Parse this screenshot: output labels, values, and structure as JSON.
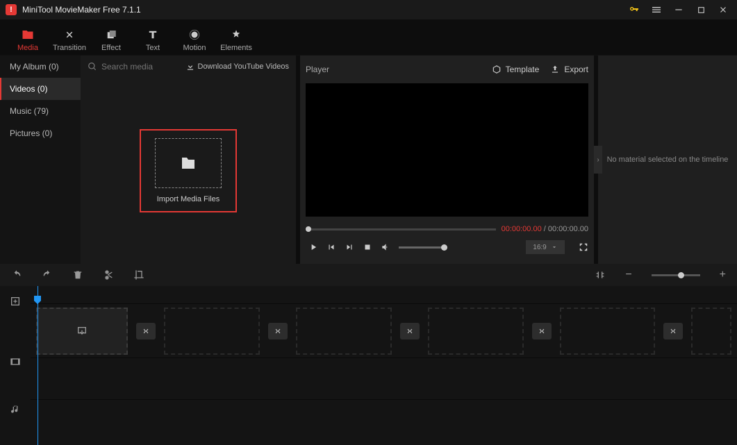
{
  "app": {
    "title": "MiniTool MovieMaker Free 7.1.1"
  },
  "tabs": {
    "media": "Media",
    "transition": "Transition",
    "effect": "Effect",
    "text": "Text",
    "motion": "Motion",
    "elements": "Elements"
  },
  "sidebar": {
    "my_album": "My Album (0)",
    "videos": "Videos (0)",
    "music": "Music (79)",
    "pictures": "Pictures (0)"
  },
  "mediabar": {
    "search_placeholder": "Search media",
    "download_yt": "Download YouTube Videos"
  },
  "import": {
    "label": "Import Media Files"
  },
  "player": {
    "label": "Player",
    "template": "Template",
    "export": "Export",
    "time_current": "00:00:00.00",
    "time_sep": " / ",
    "time_total": "00:00:00.00",
    "aspect": "16:9"
  },
  "properties": {
    "empty": "No material selected on the timeline"
  }
}
